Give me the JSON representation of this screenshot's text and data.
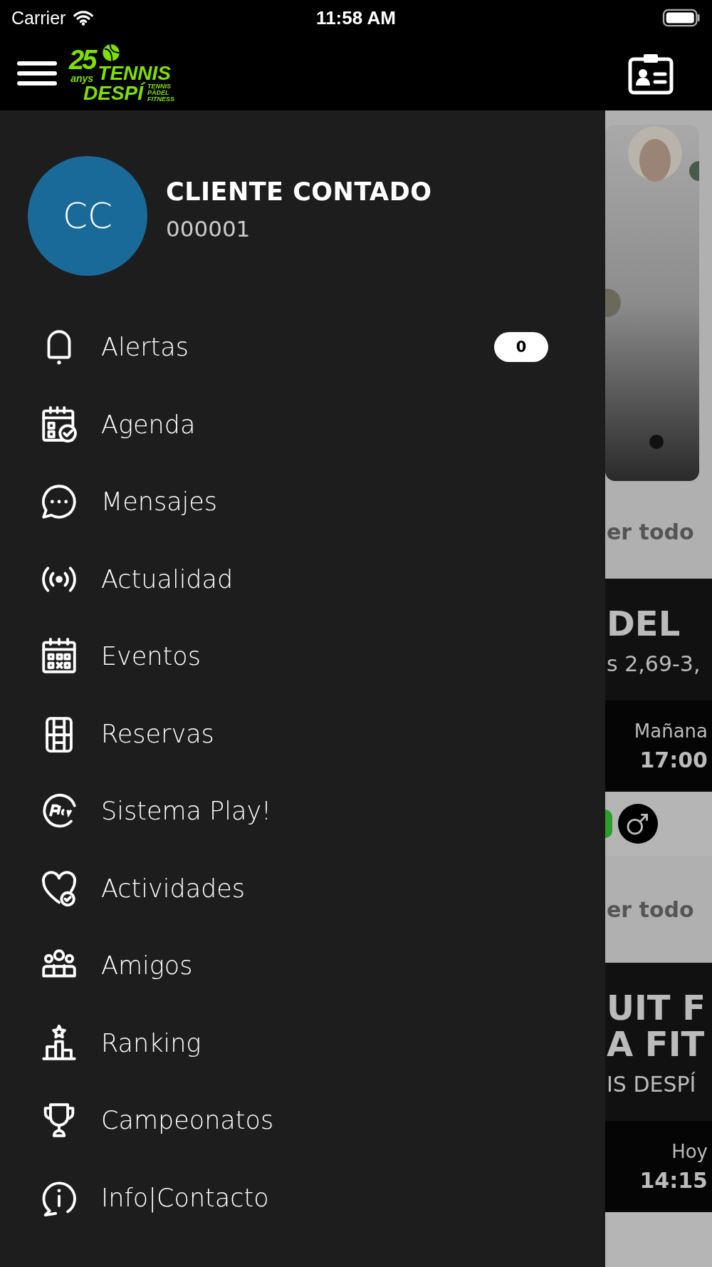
{
  "status_bar": {
    "carrier": "Carrier",
    "time": "11:58 AM"
  },
  "header": {
    "logo": {
      "number": "25",
      "sub": "anys",
      "line1": "TENNIS",
      "line2": "DESPÍ",
      "tagline": [
        "TENNIS",
        "PÀDEL",
        "FITNESS"
      ]
    }
  },
  "profile": {
    "initials": "CC",
    "name": "CLIENTE CONTADO",
    "number": "000001"
  },
  "menu": [
    {
      "label": "Alertas",
      "badge": "0"
    },
    {
      "label": "Agenda"
    },
    {
      "label": "Mensajes"
    },
    {
      "label": "Actualidad"
    },
    {
      "label": "Eventos"
    },
    {
      "label": "Reservas"
    },
    {
      "label": "Sistema Play!"
    },
    {
      "label": "Actividades"
    },
    {
      "label": "Amigos"
    },
    {
      "label": "Ranking"
    },
    {
      "label": "Campeonatos"
    },
    {
      "label": "Info|Contacto"
    }
  ],
  "background_content": {
    "link_1": "er todo",
    "card_1": {
      "title_lines": [
        "DEL"
      ],
      "subtitle": "s 2,69-3,",
      "day": "Mañana",
      "time": "17:00"
    },
    "link_2": "er todo",
    "card_2": {
      "title_lines": [
        "UIT F",
        "A FIT"
      ],
      "subtitle": "IS DESPÍ",
      "day": "Hoy",
      "time": "14:15"
    }
  }
}
